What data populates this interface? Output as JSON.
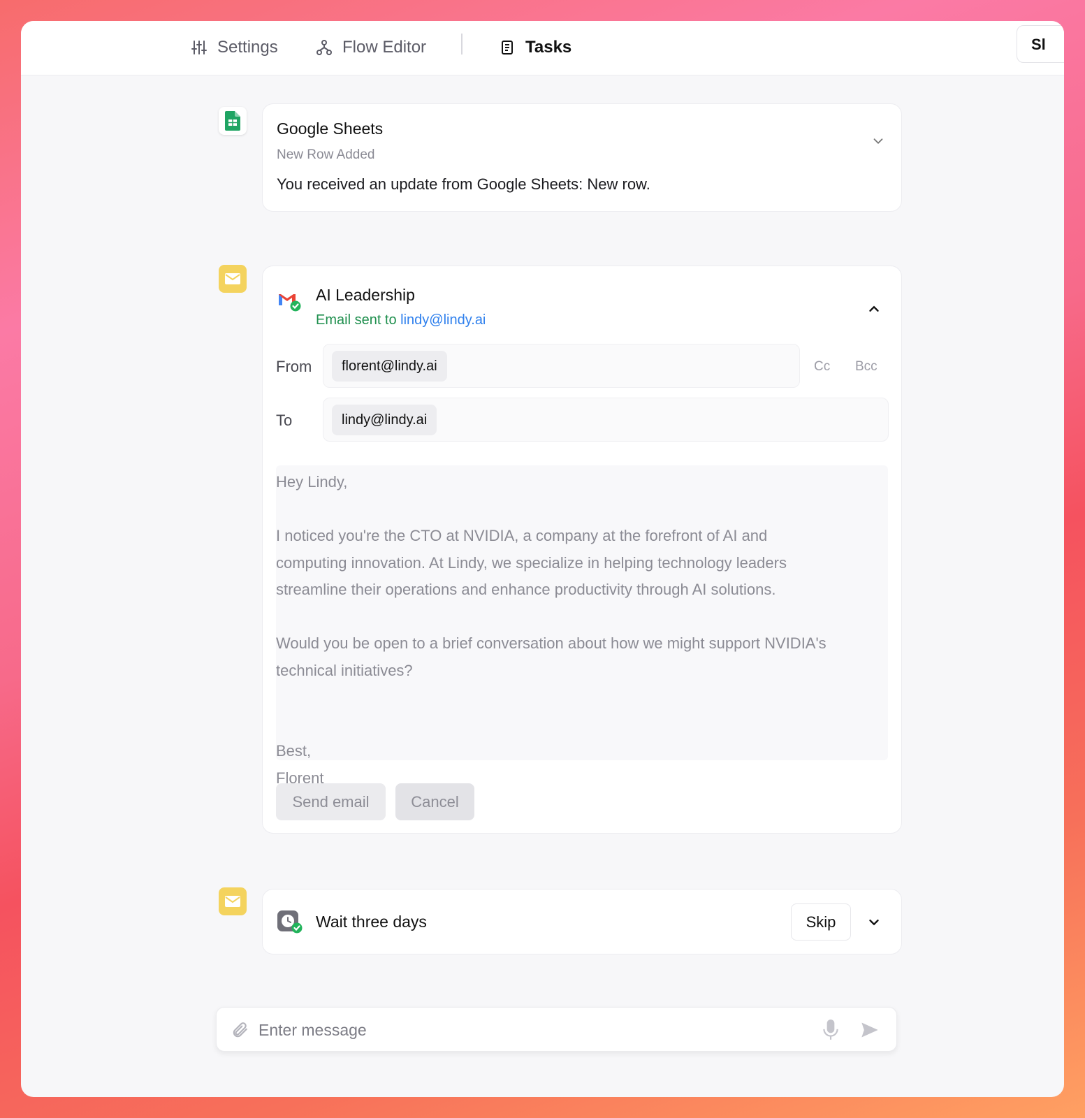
{
  "topbar": {
    "settings_label": "Settings",
    "flow_editor_label": "Flow Editor",
    "tasks_label": "Tasks",
    "share_label_partial": "Sl"
  },
  "trigger_card": {
    "title": "Google Sheets",
    "subtitle": "New Row Added",
    "message": "You received an update from Google Sheets: New row."
  },
  "email_card": {
    "title": "AI Leadership",
    "status_prefix": "Email sent to",
    "status_address": "lindy@lindy.ai",
    "from_label": "From",
    "from_value": "florent@lindy.ai",
    "cc_label": "Cc",
    "bcc_label": "Bcc",
    "to_label": "To",
    "to_value": "lindy@lindy.ai",
    "body": "Hey Lindy,\n\nI noticed you're the CTO at NVIDIA, a company at the forefront of AI and\ncomputing innovation. At Lindy, we specialize in helping technology leaders\nstreamline their operations and enhance productivity through AI solutions.\n\nWould you be open to a brief conversation about how we might support NVIDIA's\ntechnical initiatives?\n\n\nBest,\nFlorent",
    "send_label": "Send email",
    "cancel_label": "Cancel"
  },
  "wait_card": {
    "title": "Wait three days",
    "skip_label": "Skip"
  },
  "composer": {
    "placeholder": "Enter message"
  },
  "colors": {
    "accent_link": "#2f80ed",
    "success_green": "#1f8f4e",
    "mail_yellow": "#f4d35e",
    "sheets_green": "#1fa463"
  }
}
